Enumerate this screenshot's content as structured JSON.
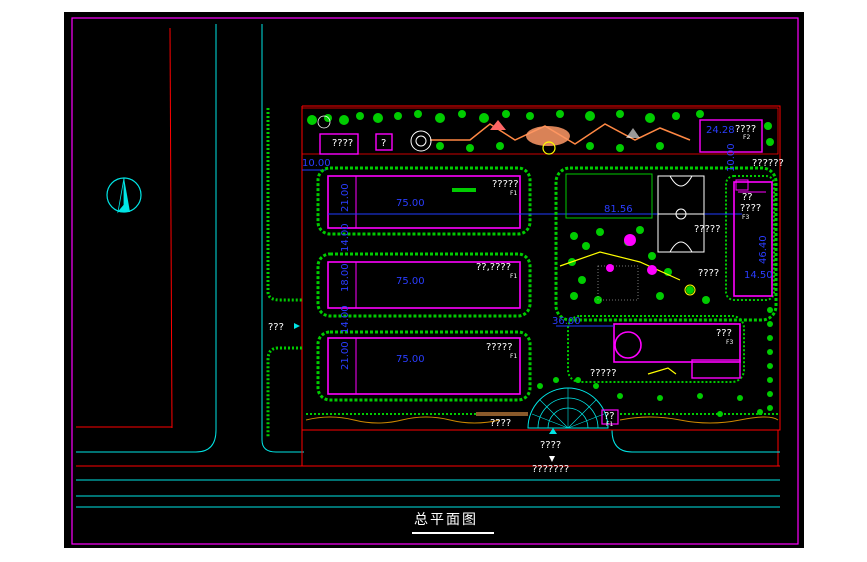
{
  "drawing": {
    "title": "总平面图",
    "colors": {
      "background": "#000000",
      "frame": "#ff00ff",
      "road": "#00e5e5",
      "boundary": "#ff0000",
      "building": "#ff00ff",
      "dimension": "#1f3cff",
      "vegetation": "#00cc00",
      "text": "#ffffff"
    },
    "north_arrow_icon": "north-arrow-icon"
  },
  "labels": {
    "entrance_left": "???",
    "top_left_small": "????",
    "top_left_small2": "?",
    "building1": "?????",
    "building1_sub": "F1",
    "building2": "??,????",
    "building2_sub": "F1",
    "building3": "?????",
    "building3_sub": "F1",
    "top_right_box": "????",
    "top_right_box_sub": "F2",
    "right_top": "??????",
    "right_bldg_a": "??",
    "right_bldg_b": "????",
    "right_bldg_sub": "F3",
    "court_label": "?????",
    "garden_label": "????",
    "canteen": "???",
    "canteen_sub": "F3",
    "canteen_left": "?????",
    "gate_left": "????",
    "gate_box": "??",
    "gate_box_sub": "F1",
    "gate_center": "????",
    "gate_bottom": "???????"
  },
  "dimensions": {
    "d_top_left": "10.00",
    "bldg_length_1": "75.00",
    "bldg_length_2": "75.00",
    "bldg_length_3": "75.00",
    "bldg_width_1": "21.00",
    "bldg_width_2": "18.00",
    "bldg_width_3": "21.00",
    "gap_1": "14.00",
    "gap_2": "14.00",
    "field": "81.56",
    "road_gap": "36.00",
    "top_box": "24.28",
    "right_tall": "46.40",
    "right_width": "14.50",
    "right_small": "10.00"
  }
}
